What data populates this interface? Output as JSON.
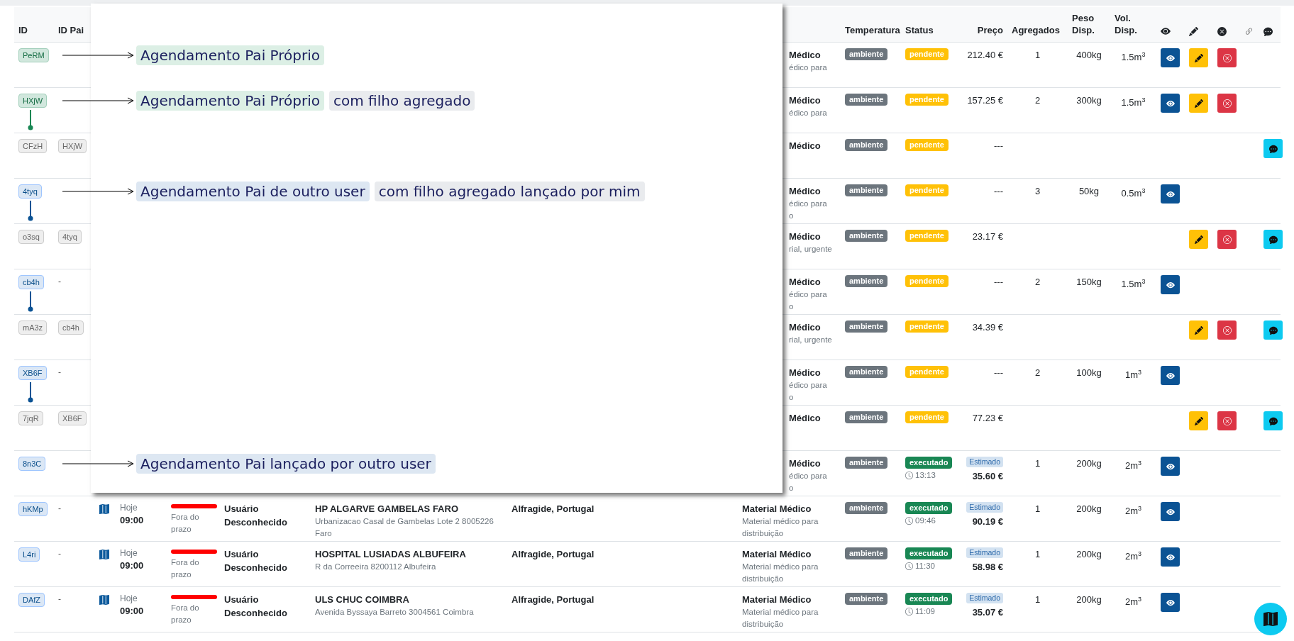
{
  "table": {
    "headers": [
      "ID",
      "ID Pai",
      "Temperatura",
      "Status",
      "Preço",
      "Agregados",
      "Peso Disp.",
      "Vol. Disp."
    ],
    "rows": [
      {
        "id": {
          "text": "PeRM",
          "kind": "own"
        },
        "linked_child": false,
        "annotation": [
          {
            "text": "Agendamento Pai Próprio",
            "kind": "own"
          }
        ],
        "material_fragment": [
          "Médico",
          "édico para"
        ],
        "temperature": "ambiente",
        "status": {
          "label": "pendente",
          "kind": "pending"
        },
        "price": {
          "value": "212.40 €"
        },
        "aggregates": "1",
        "weight": "400kg",
        "volume": "1.5m$^{3}$",
        "actions": {
          "view": true,
          "edit": true,
          "cancel": true,
          "chat": false
        }
      },
      {
        "id": {
          "text": "HXjW",
          "kind": "own"
        },
        "linked_child": true,
        "annotation": [
          {
            "text": "Agendamento Pai Próprio",
            "kind": "own"
          },
          {
            "text": "com filho agregado",
            "kind": "note"
          }
        ],
        "material_fragment": [
          "Médico",
          "édico para"
        ],
        "temperature": "ambiente",
        "status": {
          "label": "pendente",
          "kind": "pending"
        },
        "price": {
          "value": "157.25 €"
        },
        "aggregates": "2",
        "weight": "300kg",
        "volume": "1.5m$^{3}$",
        "actions": {
          "view": true,
          "edit": true,
          "cancel": true,
          "chat": false
        }
      },
      {
        "id": {
          "text": "CFzH",
          "kind": "child"
        },
        "linked_child": false,
        "parent": {
          "text": "HXjW",
          "kind": "badge"
        },
        "material_fragment": [
          "Médico"
        ],
        "temperature": "ambiente",
        "status": {
          "label": "pendente",
          "kind": "pending"
        },
        "price": {
          "value": "---"
        },
        "actions": {
          "view": false,
          "edit": false,
          "cancel": false,
          "chat": true
        }
      },
      {
        "id": {
          "text": "4tyq",
          "kind": "other"
        },
        "linked_child": true,
        "annotation": [
          {
            "text": "Agendamento Pai de outro user",
            "kind": "other"
          },
          {
            "text": "com filho agregado lançado por mim",
            "kind": "note"
          }
        ],
        "material_fragment": [
          "Médico",
          "édico para",
          "o"
        ],
        "temperature": "ambiente",
        "status": {
          "label": "pendente",
          "kind": "pending"
        },
        "price": {
          "value": "---"
        },
        "aggregates": "3",
        "weight": "50kg",
        "volume": "0.5m$^{3}$",
        "actions": {
          "view": true,
          "edit": false,
          "cancel": false,
          "chat": false
        }
      },
      {
        "id": {
          "text": "o3sq",
          "kind": "child"
        },
        "linked_child": false,
        "parent": {
          "text": "4tyq",
          "kind": "badge"
        },
        "material_fragment": [
          "Médico",
          "rial, urgente"
        ],
        "temperature": "ambiente",
        "status": {
          "label": "pendente",
          "kind": "pending"
        },
        "price": {
          "value": "23.17 €"
        },
        "actions": {
          "view": false,
          "edit": true,
          "cancel": true,
          "chat": true
        }
      },
      {
        "id": {
          "text": "cb4h",
          "kind": "other"
        },
        "linked_child": true,
        "parent": {
          "text": "-",
          "kind": "dash"
        },
        "material_fragment": [
          "Médico",
          "édico para",
          "o"
        ],
        "temperature": "ambiente",
        "status": {
          "label": "pendente",
          "kind": "pending"
        },
        "price": {
          "value": "---"
        },
        "aggregates": "2",
        "weight": "150kg",
        "volume": "1.5m$^{3}$",
        "actions": {
          "view": true,
          "edit": false,
          "cancel": false,
          "chat": false
        }
      },
      {
        "id": {
          "text": "mA3z",
          "kind": "child"
        },
        "linked_child": false,
        "parent": {
          "text": "cb4h",
          "kind": "badge"
        },
        "material_fragment": [
          "Médico",
          "rial, urgente"
        ],
        "temperature": "ambiente",
        "status": {
          "label": "pendente",
          "kind": "pending"
        },
        "price": {
          "value": "34.39 €"
        },
        "actions": {
          "view": false,
          "edit": true,
          "cancel": true,
          "chat": true
        }
      },
      {
        "id": {
          "text": "XB6F",
          "kind": "other"
        },
        "linked_child": true,
        "parent": {
          "text": "-",
          "kind": "dash"
        },
        "material_fragment": [
          "Médico",
          "édico para",
          "o"
        ],
        "temperature": "ambiente",
        "status": {
          "label": "pendente",
          "kind": "pending"
        },
        "price": {
          "value": "---"
        },
        "aggregates": "2",
        "weight": "100kg",
        "volume": "1m$^{3}$",
        "actions": {
          "view": true,
          "edit": false,
          "cancel": false,
          "chat": false
        }
      },
      {
        "id": {
          "text": "7jqR",
          "kind": "child"
        },
        "linked_child": false,
        "parent": {
          "text": "XB6F",
          "kind": "badge"
        },
        "material_fragment": [
          "Médico"
        ],
        "temperature": "ambiente",
        "status": {
          "label": "pendente",
          "kind": "pending"
        },
        "price": {
          "value": "77.23 €"
        },
        "actions": {
          "view": false,
          "edit": true,
          "cancel": true,
          "chat": true
        }
      },
      {
        "id": {
          "text": "8n3C",
          "kind": "other"
        },
        "linked_child": false,
        "annotation": [
          {
            "text": "Agendamento Pai lançado por outro user",
            "kind": "other"
          }
        ],
        "material_fragment": [
          "Médico",
          "édico para",
          "o"
        ],
        "temperature": "ambiente",
        "status": {
          "label": "executado",
          "kind": "executed",
          "time": "13:13"
        },
        "price": {
          "estimate": "Estimado",
          "value": "35.60 €"
        },
        "aggregates": "1",
        "weight": "200kg",
        "volume": "2m$^{3}$",
        "actions": {
          "view": true,
          "edit": false,
          "cancel": false,
          "chat": false
        }
      },
      {
        "id": {
          "text": "hKMp",
          "kind": "other"
        },
        "linked_child": false,
        "parent": {
          "text": "-",
          "kind": "dash"
        },
        "schedule": {
          "day": "Hoje",
          "time": "09:00"
        },
        "deadline": {
          "late": true,
          "label": "Fora do prazo"
        },
        "user": "Usuário Desconhecido",
        "destination": {
          "name": "HP ALGARVE GAMBELAS FARO",
          "address": "Urbanizacao Casal de Gambelas Lote 2 8005226 Faro"
        },
        "origin": "Alfragide, Portugal",
        "material": {
          "name": "Material Médico",
          "description": "Material médico para distribuição"
        },
        "temperature": "ambiente",
        "status": {
          "label": "executado",
          "kind": "executed",
          "time": "09:46"
        },
        "price": {
          "estimate": "Estimado",
          "value": "90.19 €"
        },
        "aggregates": "1",
        "weight": "200kg",
        "volume": "2m$^{3}$",
        "actions": {
          "view": true,
          "edit": false,
          "cancel": false,
          "chat": false
        }
      },
      {
        "id": {
          "text": "L4ri",
          "kind": "other"
        },
        "linked_child": false,
        "parent": {
          "text": "-",
          "kind": "dash"
        },
        "schedule": {
          "day": "Hoje",
          "time": "09:00"
        },
        "deadline": {
          "late": true,
          "label": "Fora do prazo"
        },
        "user": "Usuário Desconhecido",
        "destination": {
          "name": "HOSPITAL LUSIADAS ALBUFEIRA",
          "address": "R da Correeira 8200112 Albufeira"
        },
        "origin": "Alfragide, Portugal",
        "material": {
          "name": "Material Médico",
          "description": "Material médico para distribuição"
        },
        "temperature": "ambiente",
        "status": {
          "label": "executado",
          "kind": "executed",
          "time": "11:30"
        },
        "price": {
          "estimate": "Estimado",
          "value": "58.98 €"
        },
        "aggregates": "1",
        "weight": "200kg",
        "volume": "2m$^{3}$",
        "actions": {
          "view": true,
          "edit": false,
          "cancel": false,
          "chat": false
        }
      },
      {
        "id": {
          "text": "DAfZ",
          "kind": "other"
        },
        "linked_child": false,
        "parent": {
          "text": "-",
          "kind": "dash"
        },
        "schedule": {
          "day": "Hoje",
          "time": "09:00"
        },
        "deadline": {
          "late": true,
          "label": "Fora do prazo"
        },
        "user": "Usuário Desconhecido",
        "destination": {
          "name": "ULS CHUC COIMBRA",
          "address": "Avenida Byssaya Barreto 3004561 Coimbra"
        },
        "origin": "Alfragide, Portugal",
        "material": {
          "name": "Material Médico",
          "description": "Material médico para distribuição"
        },
        "temperature": "ambiente",
        "status": {
          "label": "executado",
          "kind": "executed",
          "time": "11:09"
        },
        "price": {
          "estimate": "Estimado",
          "value": "35.07 €"
        },
        "aggregates": "1",
        "weight": "200kg",
        "volume": "2m$^{3}$",
        "actions": {
          "view": true,
          "edit": false,
          "cancel": false,
          "chat": false
        }
      }
    ]
  }
}
